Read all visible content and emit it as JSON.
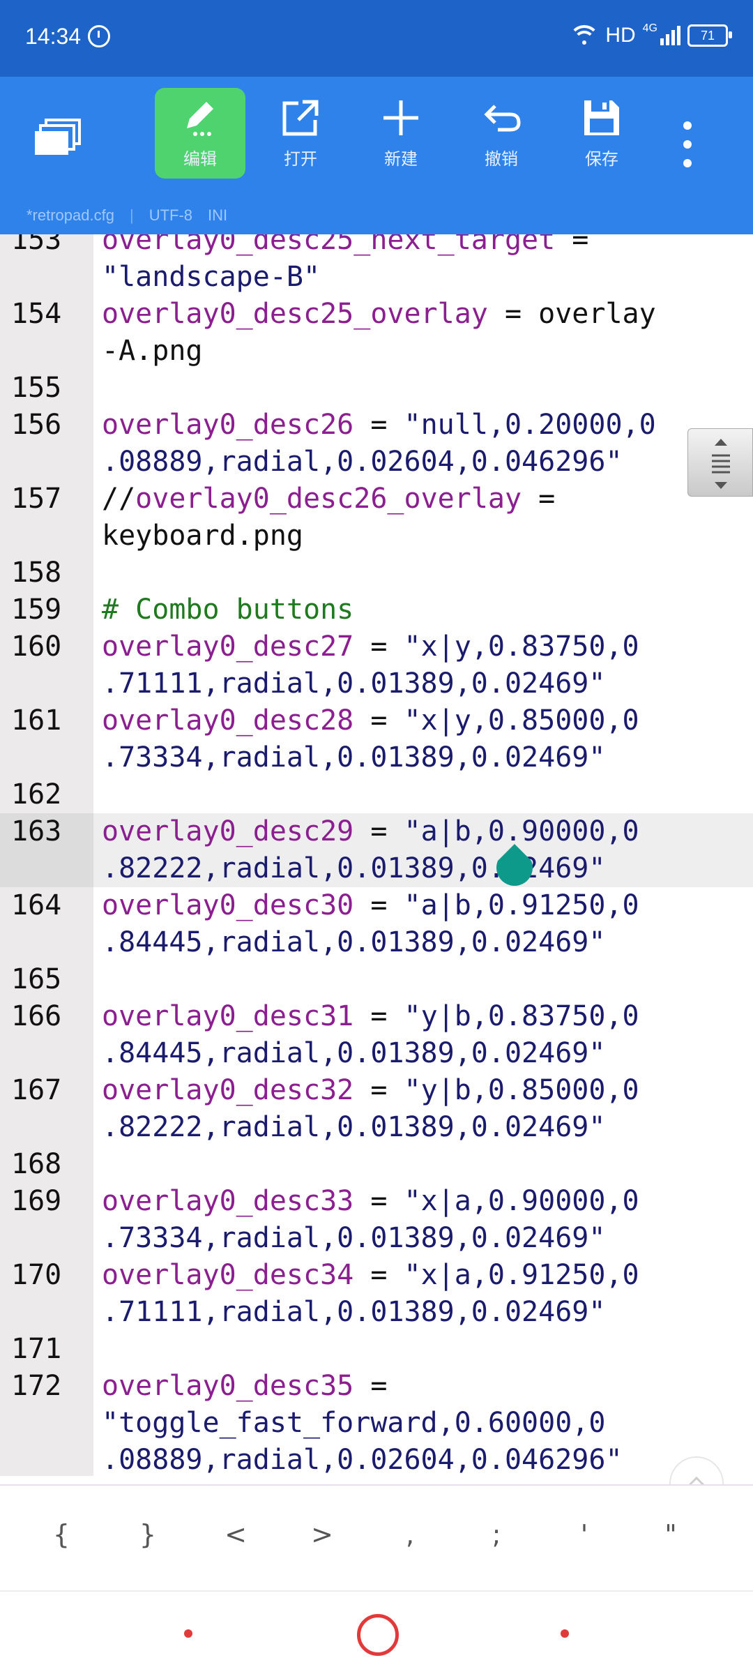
{
  "status": {
    "time": "14:34",
    "hd_label": "HD",
    "network": "4G",
    "battery": "71"
  },
  "toolbar": {
    "buttons": [
      {
        "label": "编辑",
        "icon": "pencil-icon",
        "active": true
      },
      {
        "label": "打开",
        "icon": "open-external-icon"
      },
      {
        "label": "新建",
        "icon": "plus-icon"
      },
      {
        "label": "撤销",
        "icon": "undo-icon"
      },
      {
        "label": "保存",
        "icon": "save-icon"
      }
    ]
  },
  "file": {
    "name": "*retropad.cfg",
    "encoding": "UTF-8",
    "type": "INI"
  },
  "editor": {
    "current_line": "163",
    "lines": [
      {
        "num": "153",
        "segments": [
          [
            "k",
            "overlay0_desc25_next_target"
          ],
          [
            "p",
            " ="
          ]
        ]
      },
      {
        "num": "",
        "segments": [
          [
            "v",
            "\"landscape-B\""
          ]
        ]
      },
      {
        "num": "154",
        "segments": [
          [
            "k",
            "overlay0_desc25_overlay"
          ],
          [
            "p",
            " = overlay"
          ]
        ]
      },
      {
        "num": "",
        "segments": [
          [
            "p",
            "-A.png"
          ]
        ]
      },
      {
        "num": "155",
        "segments": []
      },
      {
        "num": "156",
        "segments": [
          [
            "k",
            "overlay0_desc26"
          ],
          [
            "p",
            " = "
          ],
          [
            "v",
            "\"null,0.20000,0"
          ]
        ]
      },
      {
        "num": "",
        "segments": [
          [
            "v",
            ".08889,radial,0.02604,0.046296\""
          ]
        ]
      },
      {
        "num": "157",
        "segments": [
          [
            "p",
            "//"
          ],
          [
            "k",
            "overlay0_desc26_overlay"
          ],
          [
            "p",
            " ="
          ]
        ]
      },
      {
        "num": "",
        "segments": [
          [
            "p",
            "keyboard.png"
          ]
        ]
      },
      {
        "num": "158",
        "segments": []
      },
      {
        "num": "159",
        "segments": [
          [
            "c",
            "# Combo buttons"
          ]
        ]
      },
      {
        "num": "160",
        "segments": [
          [
            "k",
            "overlay0_desc27"
          ],
          [
            "p",
            " = "
          ],
          [
            "v",
            "\"x|y,0.83750,0"
          ]
        ]
      },
      {
        "num": "",
        "segments": [
          [
            "v",
            ".71111,radial,0.01389,0.02469\""
          ]
        ]
      },
      {
        "num": "161",
        "segments": [
          [
            "k",
            "overlay0_desc28"
          ],
          [
            "p",
            " = "
          ],
          [
            "v",
            "\"x|y,0.85000,0"
          ]
        ]
      },
      {
        "num": "",
        "segments": [
          [
            "v",
            ".73334,radial,0.01389,0.02469\""
          ]
        ]
      },
      {
        "num": "162",
        "segments": []
      },
      {
        "num": "163",
        "segments": [
          [
            "k",
            "overlay0_desc29"
          ],
          [
            "p",
            " = "
          ],
          [
            "v",
            "\"a|b,0.90000,0"
          ]
        ]
      },
      {
        "num": "",
        "segments": [
          [
            "v",
            ".82222,radial,0.01389,0.02469\""
          ]
        ]
      },
      {
        "num": "164",
        "segments": [
          [
            "k",
            "overlay0_desc30"
          ],
          [
            "p",
            " = "
          ],
          [
            "v",
            "\"a|b,0.91250,0"
          ]
        ]
      },
      {
        "num": "",
        "segments": [
          [
            "v",
            ".84445,radial,0.01389,0.02469\""
          ]
        ]
      },
      {
        "num": "165",
        "segments": []
      },
      {
        "num": "166",
        "segments": [
          [
            "k",
            "overlay0_desc31"
          ],
          [
            "p",
            " = "
          ],
          [
            "v",
            "\"y|b,0.83750,0"
          ]
        ]
      },
      {
        "num": "",
        "segments": [
          [
            "v",
            ".84445,radial,0.01389,0.02469\""
          ]
        ]
      },
      {
        "num": "167",
        "segments": [
          [
            "k",
            "overlay0_desc32"
          ],
          [
            "p",
            " = "
          ],
          [
            "v",
            "\"y|b,0.85000,0"
          ]
        ]
      },
      {
        "num": "",
        "segments": [
          [
            "v",
            ".82222,radial,0.01389,0.02469\""
          ]
        ]
      },
      {
        "num": "168",
        "segments": []
      },
      {
        "num": "169",
        "segments": [
          [
            "k",
            "overlay0_desc33"
          ],
          [
            "p",
            " = "
          ],
          [
            "v",
            "\"x|a,0.90000,0"
          ]
        ]
      },
      {
        "num": "",
        "segments": [
          [
            "v",
            ".73334,radial,0.01389,0.02469\""
          ]
        ]
      },
      {
        "num": "170",
        "segments": [
          [
            "k",
            "overlay0_desc34"
          ],
          [
            "p",
            " = "
          ],
          [
            "v",
            "\"x|a,0.91250,0"
          ]
        ]
      },
      {
        "num": "",
        "segments": [
          [
            "v",
            ".71111,radial,0.01389,0.02469\""
          ]
        ]
      },
      {
        "num": "171",
        "segments": []
      },
      {
        "num": "172",
        "segments": [
          [
            "k",
            "overlay0_desc35"
          ],
          [
            "p",
            " ="
          ]
        ]
      },
      {
        "num": "",
        "segments": [
          [
            "v",
            "\"toggle_fast_forward,0.60000,0"
          ]
        ]
      },
      {
        "num": "",
        "segments": [
          [
            "v",
            ".08889,radial,0.02604,0.046296\""
          ]
        ]
      }
    ]
  },
  "symbols": [
    "{",
    "}",
    "<",
    ">",
    ",",
    ";",
    "'",
    "\""
  ],
  "colors": {
    "statusbar": "#1e63c8",
    "toolbar": "#2f82ea",
    "active_button": "#4fd36e",
    "key": "#8b1f8f",
    "value": "#1b1b6e",
    "comment": "#1f7a1f",
    "nav": "#e23a3a"
  }
}
